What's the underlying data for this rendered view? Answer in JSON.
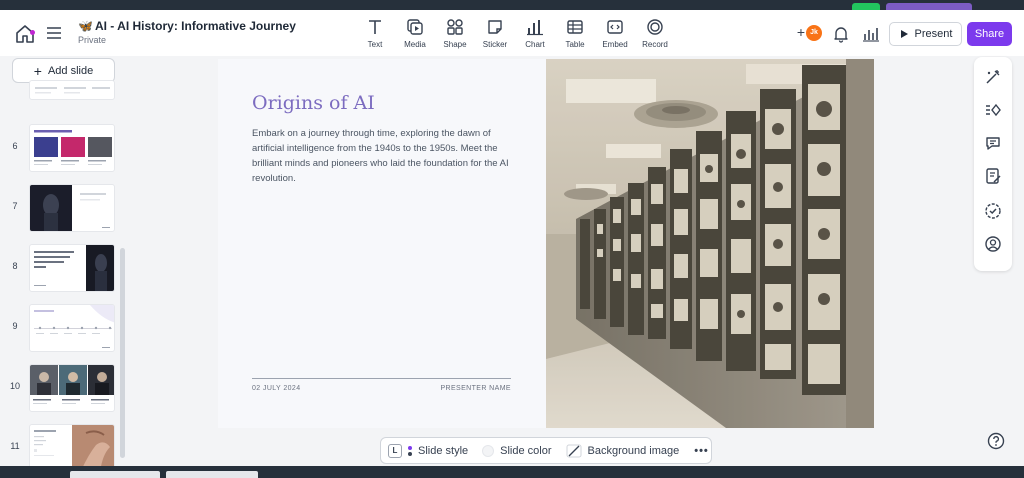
{
  "document": {
    "emoji": "🦋",
    "title": "AI - AI History: Informative Journey",
    "visibility": "Private"
  },
  "toolbar": {
    "items": [
      {
        "label": "Text",
        "icon": "text-icon"
      },
      {
        "label": "Media",
        "icon": "media-icon"
      },
      {
        "label": "Shape",
        "icon": "shape-icon"
      },
      {
        "label": "Sticker",
        "icon": "sticker-icon"
      },
      {
        "label": "Chart",
        "icon": "chart-icon"
      },
      {
        "label": "Table",
        "icon": "table-icon"
      },
      {
        "label": "Embed",
        "icon": "embed-icon"
      },
      {
        "label": "Record",
        "icon": "record-icon"
      }
    ]
  },
  "header_actions": {
    "add_collaborator": "+",
    "avatar_initials": "Jk",
    "present_label": "Present",
    "share_label": "Share"
  },
  "sidebar": {
    "add_slide_label": "Add slide",
    "slides": [
      {
        "number": ""
      },
      {
        "number": "6"
      },
      {
        "number": "7"
      },
      {
        "number": "8"
      },
      {
        "number": "9"
      },
      {
        "number": "10"
      },
      {
        "number": "11"
      }
    ]
  },
  "slide": {
    "title": "Origins of AI",
    "body": "Embark on a journey through time, exploring the dawn of artificial intelligence from the 1940s to the 1950s. Meet the brilliant minds and pioneers who laid the foundation for the AI revolution.",
    "date": "02 JULY 2024",
    "presenter": "PRESENTER NAME"
  },
  "bottom_bar": {
    "style_badge": "L",
    "slide_style": "Slide style",
    "slide_color": "Slide color",
    "background_image": "Background image",
    "more": "•••"
  },
  "colors": {
    "accent": "#7c3aed",
    "title": "#7c6cc0"
  }
}
